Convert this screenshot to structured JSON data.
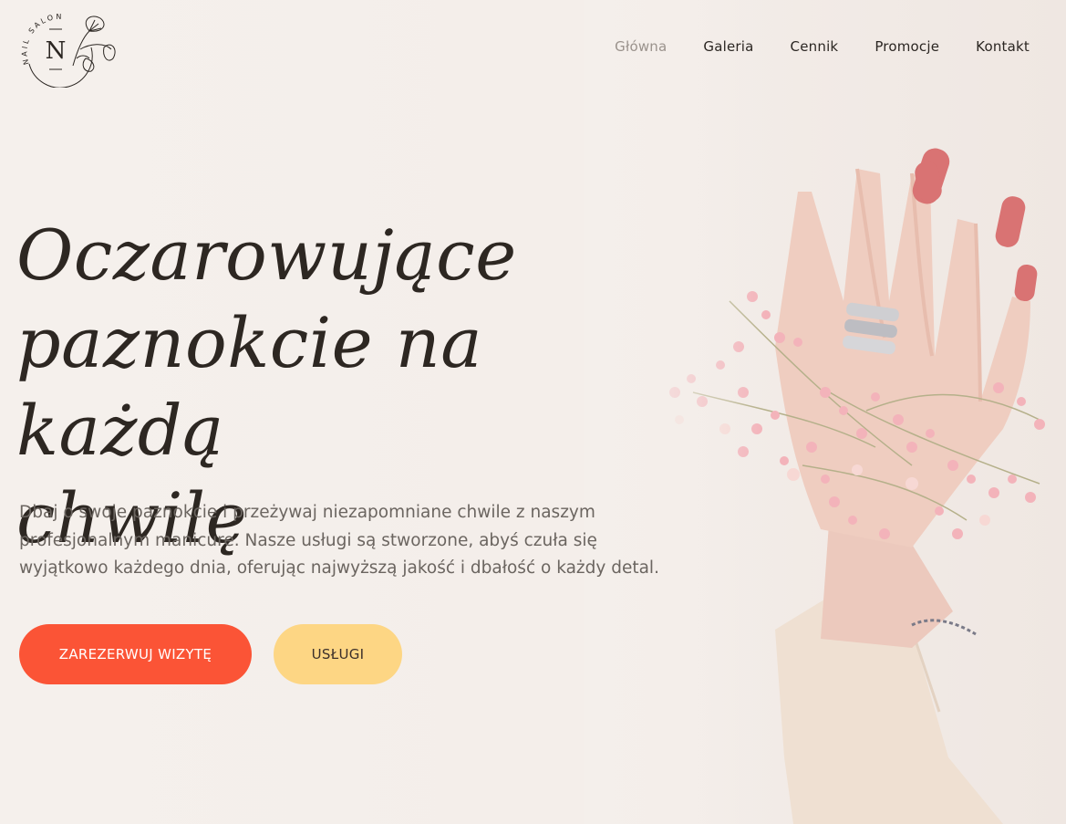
{
  "brand": {
    "logo_letter": "N",
    "logo_text": "NAIL SALON"
  },
  "nav": {
    "items": [
      {
        "label": "Główna",
        "active": true
      },
      {
        "label": "Galeria",
        "active": false
      },
      {
        "label": "Cennik",
        "active": false
      },
      {
        "label": "Promocje",
        "active": false
      },
      {
        "label": "Kontakt",
        "active": false
      }
    ]
  },
  "hero": {
    "headline_lines": [
      "Oczarowujące",
      "paznokcie na każdą",
      "chwilę"
    ],
    "lead": "Dbaj o swoje paznokcie i przeżywaj niezapomniane chwile z naszym profesjonalnym manicure. Nasze usługi są stworzone, abyś czuła się wyjątkowo każdego dnia, oferując najwyższą jakość i dbałość o każdy detal.",
    "primary_button": "ZAREZERWUJ WIZYTĘ",
    "secondary_button": "USŁUGI"
  },
  "colors": {
    "background": "#f4efeb",
    "primary_button": "#fb5436",
    "secondary_button": "#fdd684",
    "nail_polish": "#d97373",
    "active_nav": "#9a928c"
  }
}
